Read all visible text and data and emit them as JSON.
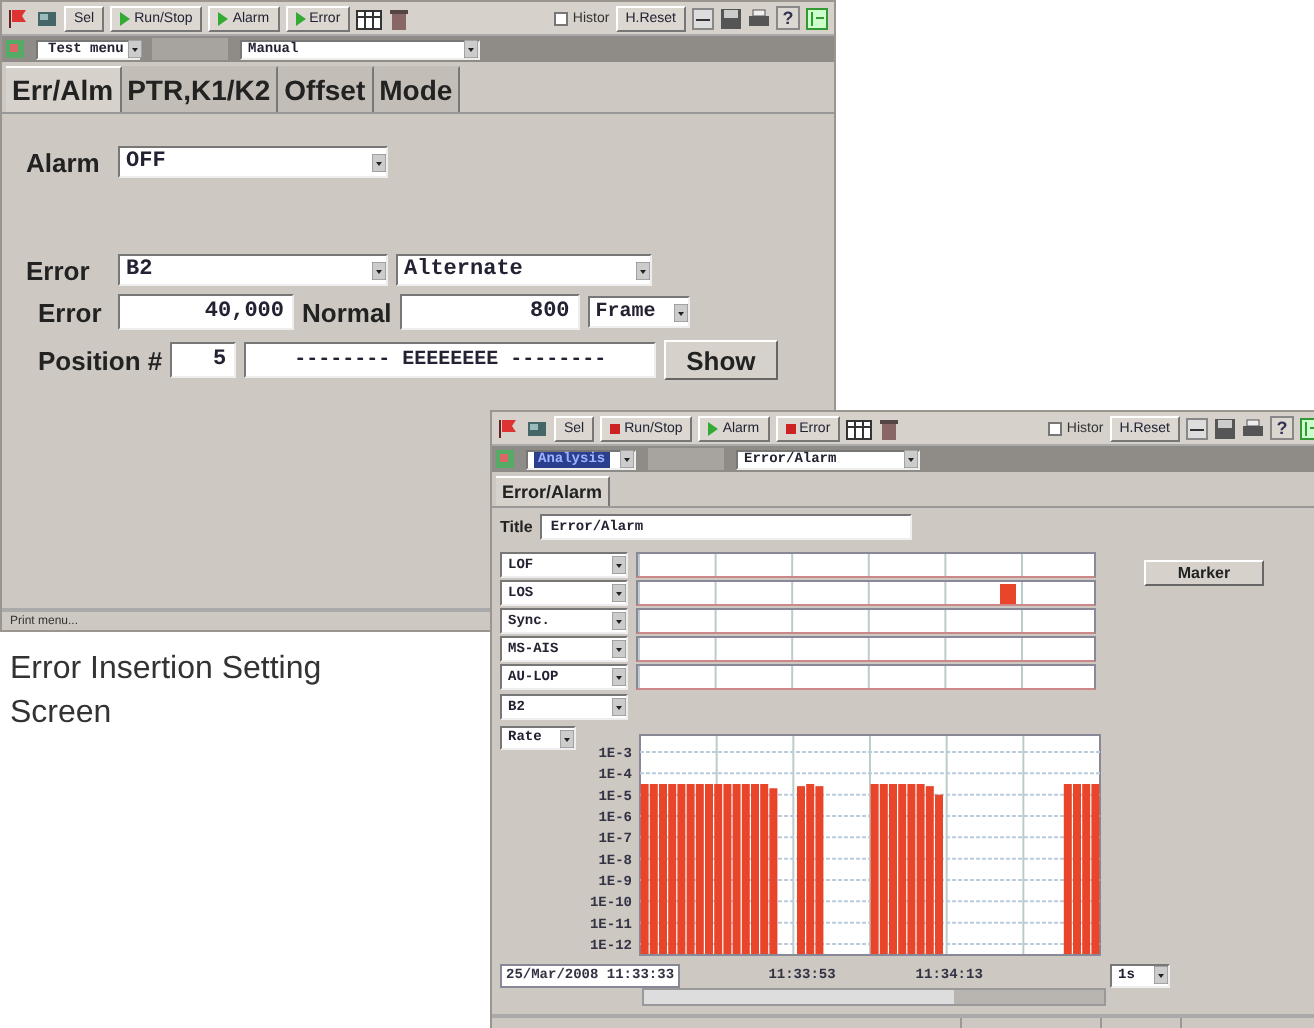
{
  "settings_window": {
    "toolbar": {
      "buttons": [
        {
          "label": "Sel",
          "kind": "plain"
        },
        {
          "label": "Run/Stop",
          "kind": "play"
        },
        {
          "label": "Alarm",
          "kind": "play"
        },
        {
          "label": "Error",
          "kind": "play"
        }
      ],
      "history": {
        "label": "Histor",
        "checked": false
      },
      "reset": "H.Reset",
      "help": "?"
    },
    "menu_bar": {
      "menu": {
        "value": "Test menu",
        "highlighted": false
      },
      "mode": "Manual"
    },
    "tabs": [
      {
        "label": "Err/Alm",
        "selected": true
      },
      {
        "label": "PTR,K1/K2",
        "selected": false
      },
      {
        "label": "Offset",
        "selected": false
      },
      {
        "label": "Mode",
        "selected": false
      }
    ],
    "alarm": {
      "label": "Alarm",
      "value": "OFF"
    },
    "error": {
      "label": "Error",
      "type": "B2",
      "mode": "Alternate"
    },
    "counts": {
      "error_label": "Error",
      "error_value": "40,000",
      "normal_label": "Normal",
      "normal_value": "800",
      "unit": "Frame"
    },
    "position": {
      "label": "Position #",
      "value": "5",
      "pattern": "-------- EEEEEEEE --------",
      "button": "Show"
    },
    "status_bar": "Print menu..."
  },
  "caption": "Error Insertion Setting Screen",
  "analysis_window": {
    "toolbar": {
      "buttons": [
        {
          "label": "Sel",
          "kind": "plain"
        },
        {
          "label": "Run/Stop",
          "kind": "stop"
        },
        {
          "label": "Alarm",
          "kind": "play"
        },
        {
          "label": "Error",
          "kind": "stop"
        }
      ],
      "history": {
        "label": "Histor",
        "checked": false
      },
      "reset": "H.Reset",
      "help": "?"
    },
    "menu_bar": {
      "menu": {
        "value": "Analysis",
        "highlighted": true
      },
      "mode": "Error/Alarm"
    },
    "tabs": [
      {
        "label": "Error/Alarm",
        "selected": true
      }
    ],
    "title": {
      "label": "Title",
      "value": "Error/Alarm"
    },
    "alarm_rows": [
      {
        "name": "LOF",
        "alarm": false
      },
      {
        "name": "LOS",
        "alarm": true
      },
      {
        "name": "Sync.",
        "alarm": false
      },
      {
        "name": "MS-AIS",
        "alarm": false
      },
      {
        "name": "AU-LOP",
        "alarm": false
      }
    ],
    "marker_button": "Marker",
    "error_select": "B2",
    "scale_select": "Rate",
    "rate_scale": [
      "1E-3",
      "1E-4",
      "1E-5",
      "1E-6",
      "1E-7",
      "1E-8",
      "1E-9",
      "1E-10",
      "1E-11",
      "1E-12"
    ],
    "start_time": "25/Mar/2008 11:33:33",
    "time_labels": [
      "11:33:53",
      "11:34:13"
    ],
    "interval_select": "1s"
  }
}
